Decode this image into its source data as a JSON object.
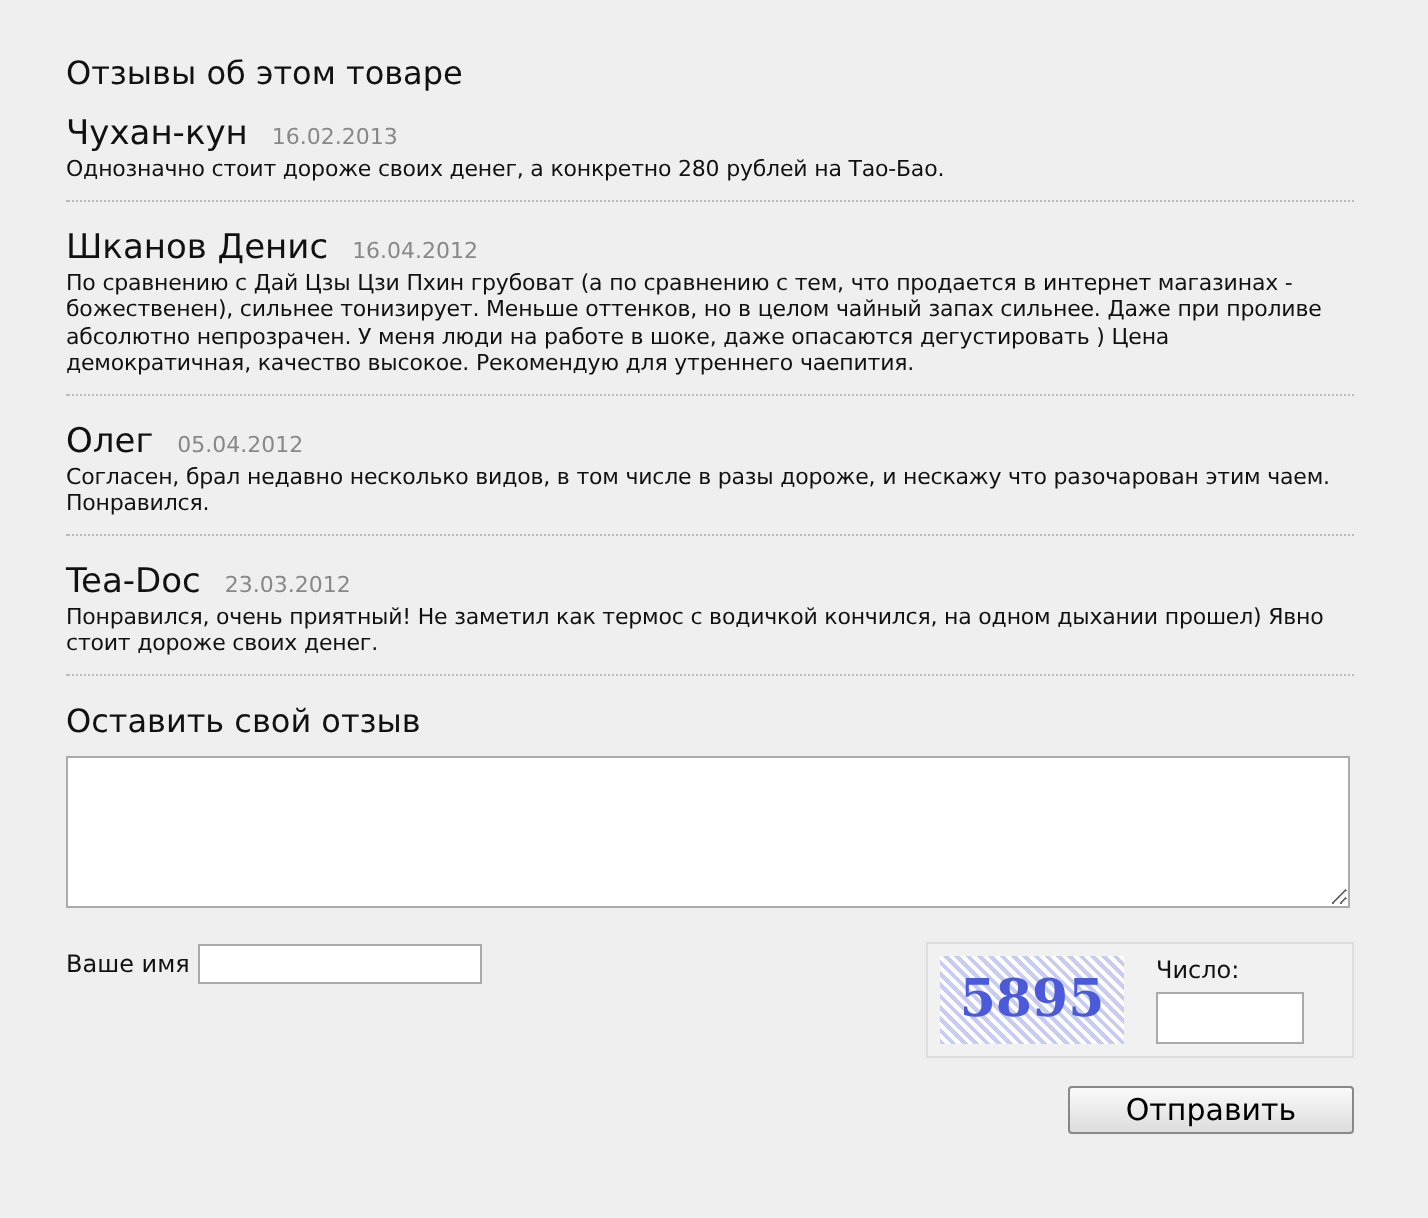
{
  "reviews_title": "Отзывы об этом товаре",
  "reviews": [
    {
      "author": "Чухан-кун",
      "date": "16.02.2013",
      "text": "Однозначно стоит дороже своих денег, а конкретно 280 рублей на Тао-Бао."
    },
    {
      "author": "Шканов Денис",
      "date": "16.04.2012",
      "text": "По сравнению с Дай Цзы Цзи Пхин грубоват (а по сравнению с тем, что продается в интернет магазинах - божественен), сильнее тонизирует. Меньше оттенков, но в целом чайный запах сильнее. Даже при проливе абсолютно непрозрачен. У меня люди на работе в шоке, даже опасаются дегустировать ) Цена демократичная, качество высокое. Рекомендую для утреннего чаепития."
    },
    {
      "author": "Олег",
      "date": "05.04.2012",
      "text": "Согласен, брал недавно несколько видов, в том числе в разы дороже, и нескажу что разочарован этим чаем. Понравился."
    },
    {
      "author": "Tea-Doc",
      "date": "23.03.2012",
      "text": "Понравился, очень приятный! Не заметил как термос с водичкой кончился, на одном дыхании прошел) Явно стоит дороже своих денег."
    }
  ],
  "form": {
    "title": "Оставить свой отзыв",
    "name_label": "Ваше имя",
    "captcha": "5895",
    "number_label": "Число:",
    "submit": "Отправить"
  }
}
